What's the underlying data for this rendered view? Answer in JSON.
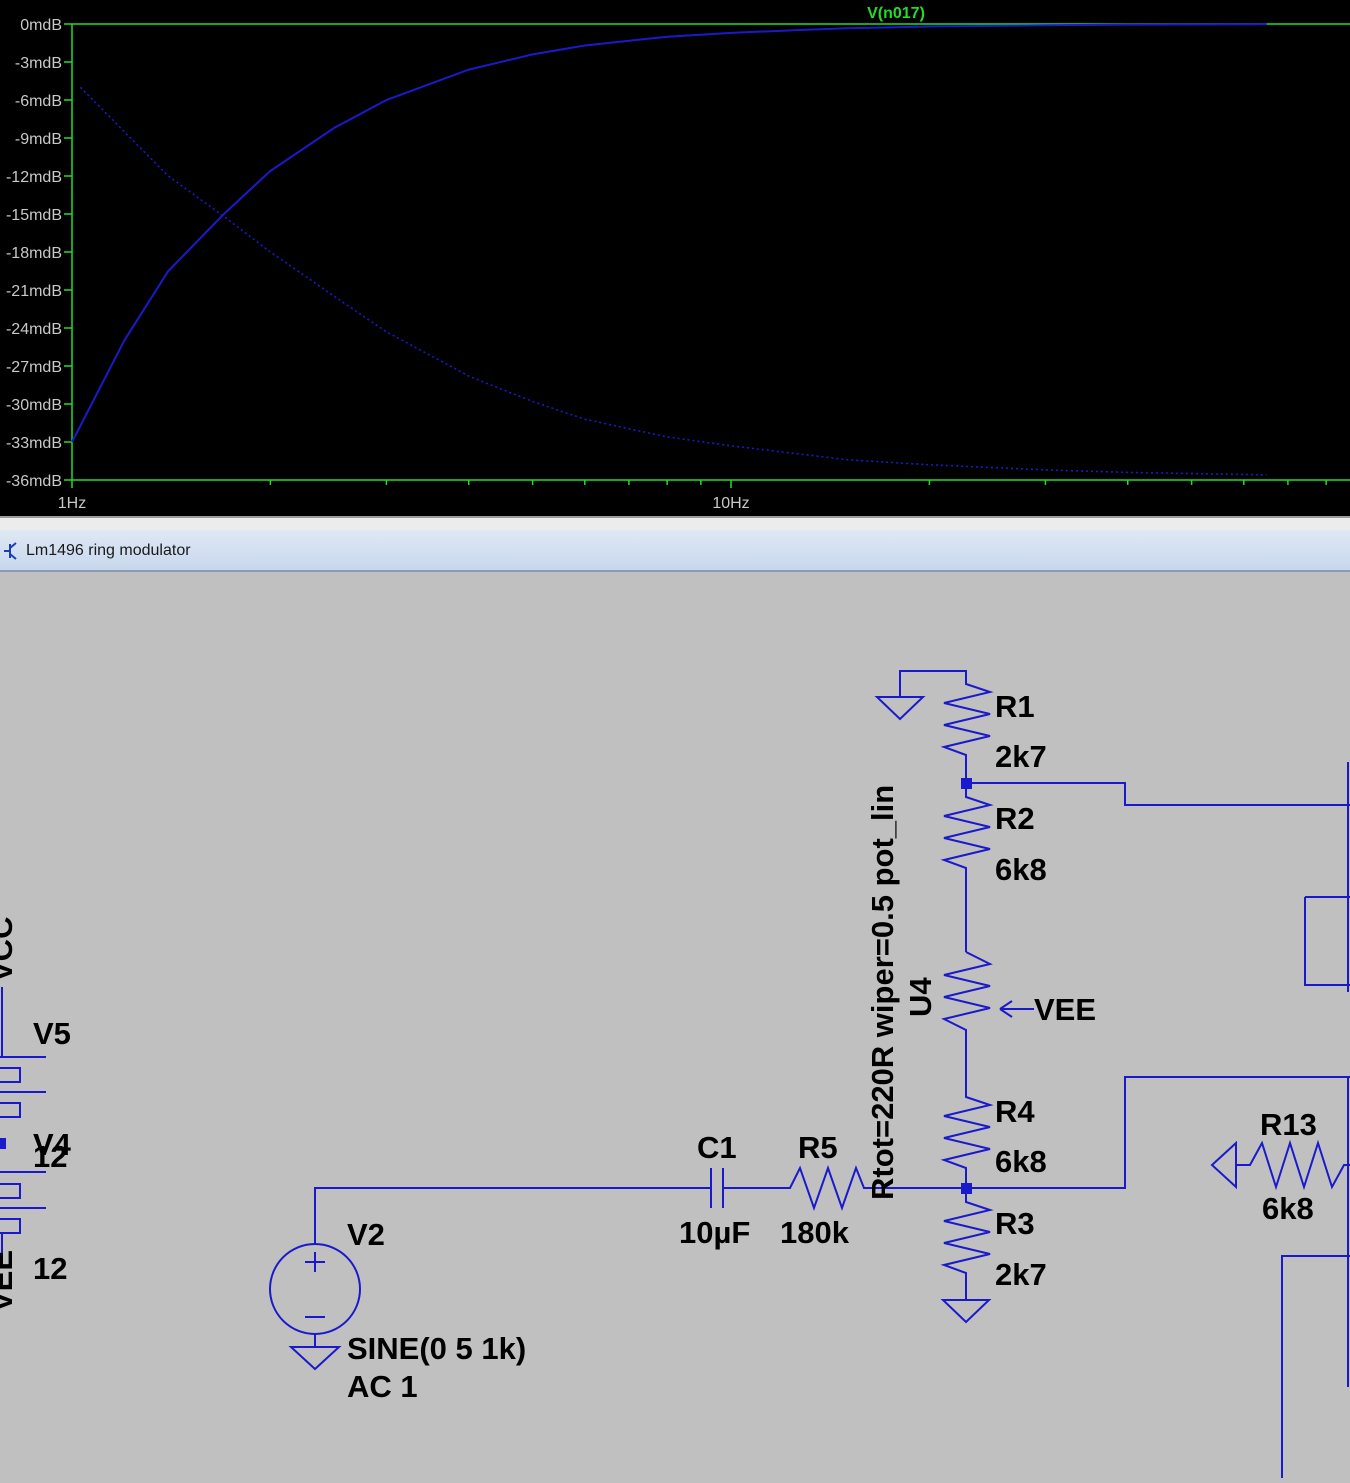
{
  "plot": {
    "trace_label": "V(n017)",
    "grid_color": "#22dd22",
    "trace_color": "#1a1acc",
    "y_ticks": [
      "0mdB",
      "-3mdB",
      "-6mdB",
      "-9mdB",
      "-12mdB",
      "-15mdB",
      "-18mdB",
      "-21mdB",
      "-24mdB",
      "-27mdB",
      "-30mdB",
      "-33mdB",
      "-36mdB"
    ],
    "x_ticks": [
      "1Hz",
      "10Hz"
    ]
  },
  "chart_data": {
    "type": "line",
    "x_scale": "log",
    "xlim": [
      1,
      65
    ],
    "ylim": [
      -36,
      0
    ],
    "series": [
      {
        "style": "solid",
        "x": [
          1,
          1.2,
          1.4,
          1.7,
          2,
          2.5,
          3,
          4,
          5,
          6,
          8,
          10,
          13,
          15,
          20,
          30,
          40,
          65
        ],
        "y": [
          -33,
          -25,
          -19.5,
          -15,
          -11.6,
          -8.2,
          -6,
          -3.6,
          -2.4,
          -1.7,
          -1.0,
          -0.7,
          -0.45,
          -0.33,
          -0.2,
          -0.1,
          -0.05,
          -0.02
        ]
      },
      {
        "style": "dotted",
        "x": [
          1.03,
          1.2,
          1.4,
          1.7,
          2,
          2.5,
          3,
          4,
          5,
          6,
          8,
          10,
          15,
          20,
          30,
          40,
          65
        ],
        "y": [
          -5,
          -8.5,
          -12,
          -15.2,
          -18,
          -21.5,
          -24.3,
          -27.8,
          -29.8,
          -31.2,
          -32.6,
          -33.3,
          -34.4,
          -34.8,
          -35.2,
          -35.4,
          -35.6
        ]
      }
    ]
  },
  "window": {
    "title": "Lm1496 ring modulator"
  },
  "schematic": {
    "components": {
      "r1_name": "R1",
      "r1_value": "2k7",
      "r2_name": "R2",
      "r2_value": "6k8",
      "u4_name": "U4",
      "u4_params": "Rtot=220R wiper=0.5 pot_lin",
      "vee_label": "VEE",
      "r4_name": "R4",
      "r4_value": "6k8",
      "r3_name": "R3",
      "r3_value": "2k7",
      "c1_name": "C1",
      "c1_value": "10µF",
      "r5_name": "R5",
      "r5_value": "180k",
      "v2_name": "V2",
      "v2_spec": "SINE(0 5 1k)",
      "v2_ac": "AC 1",
      "r13_name": "R13",
      "r13_value": "6k8",
      "v5_name": "V5",
      "v4_name": "V4",
      "v5_value": "12",
      "v4_value": "12",
      "vcc_label": "VCC",
      "vee_left_label": "VEE"
    }
  }
}
